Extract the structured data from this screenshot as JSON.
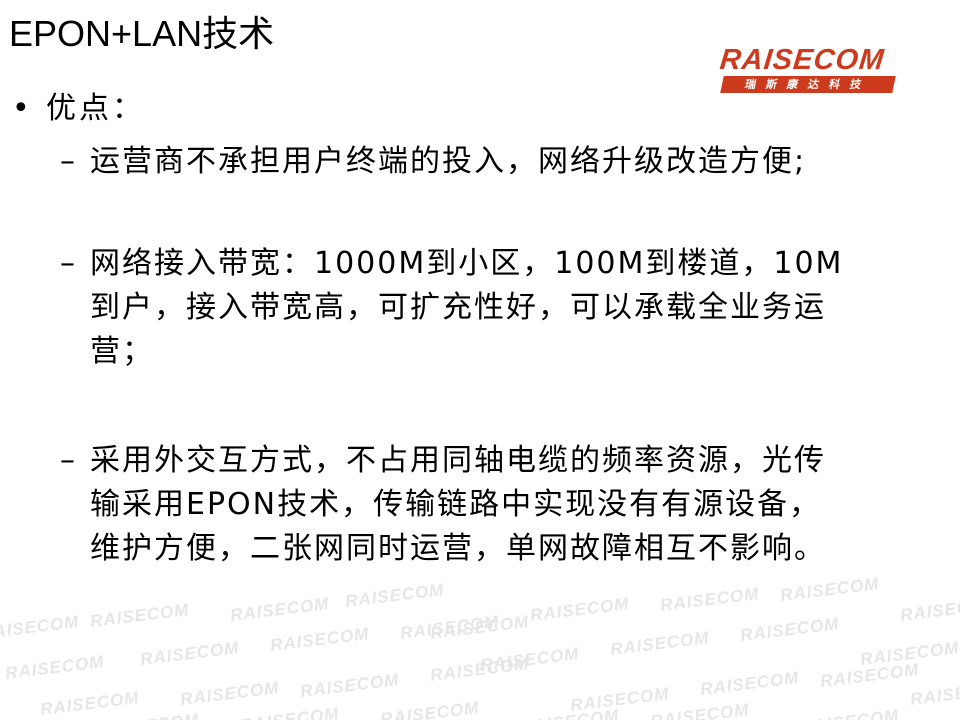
{
  "slide": {
    "title": "EPON+LAN技术"
  },
  "logo": {
    "wordmark": "RAISECOM",
    "chinese": "瑞斯康达科技"
  },
  "watermark_text": "RAISECOM",
  "content": {
    "bullet": "优点：",
    "dash": "–",
    "items": [
      {
        "lines": [
          "运营商不承担用户终端的投入，网络升级改造方便;"
        ]
      },
      {
        "lines": [
          "网络接入带宽：1000M到小区，100M到楼道，10M",
          "到户，接入带宽高，可扩充性好，可以承载全业务运",
          "营；"
        ]
      },
      {
        "lines": [
          "采用外交互方式，不占用同轴电缆的频率资源，光传",
          "输采用EPON技术，传输链路中实现没有有源设备，",
          "维护方便，二张网同时运营，单网故障相互不影响。"
        ]
      }
    ]
  },
  "colors": {
    "brand_red": "#cc3b1d",
    "watermark_gray": "#e6e6e6"
  }
}
